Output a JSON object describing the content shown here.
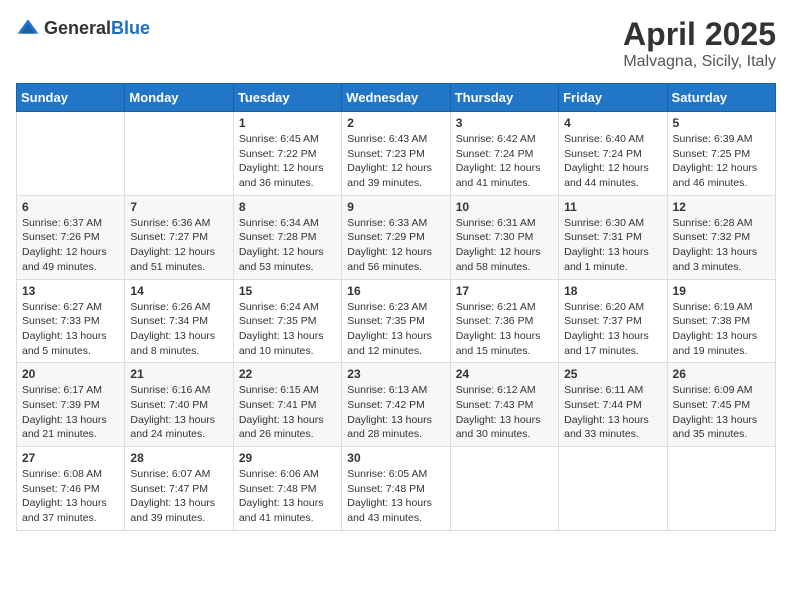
{
  "logo": {
    "text_general": "General",
    "text_blue": "Blue"
  },
  "title": {
    "month": "April 2025",
    "location": "Malvagna, Sicily, Italy"
  },
  "days_of_week": [
    "Sunday",
    "Monday",
    "Tuesday",
    "Wednesday",
    "Thursday",
    "Friday",
    "Saturday"
  ],
  "weeks": [
    [
      {
        "day": "",
        "info": ""
      },
      {
        "day": "",
        "info": ""
      },
      {
        "day": "1",
        "info": "Sunrise: 6:45 AM\nSunset: 7:22 PM\nDaylight: 12 hours and 36 minutes."
      },
      {
        "day": "2",
        "info": "Sunrise: 6:43 AM\nSunset: 7:23 PM\nDaylight: 12 hours and 39 minutes."
      },
      {
        "day": "3",
        "info": "Sunrise: 6:42 AM\nSunset: 7:24 PM\nDaylight: 12 hours and 41 minutes."
      },
      {
        "day": "4",
        "info": "Sunrise: 6:40 AM\nSunset: 7:24 PM\nDaylight: 12 hours and 44 minutes."
      },
      {
        "day": "5",
        "info": "Sunrise: 6:39 AM\nSunset: 7:25 PM\nDaylight: 12 hours and 46 minutes."
      }
    ],
    [
      {
        "day": "6",
        "info": "Sunrise: 6:37 AM\nSunset: 7:26 PM\nDaylight: 12 hours and 49 minutes."
      },
      {
        "day": "7",
        "info": "Sunrise: 6:36 AM\nSunset: 7:27 PM\nDaylight: 12 hours and 51 minutes."
      },
      {
        "day": "8",
        "info": "Sunrise: 6:34 AM\nSunset: 7:28 PM\nDaylight: 12 hours and 53 minutes."
      },
      {
        "day": "9",
        "info": "Sunrise: 6:33 AM\nSunset: 7:29 PM\nDaylight: 12 hours and 56 minutes."
      },
      {
        "day": "10",
        "info": "Sunrise: 6:31 AM\nSunset: 7:30 PM\nDaylight: 12 hours and 58 minutes."
      },
      {
        "day": "11",
        "info": "Sunrise: 6:30 AM\nSunset: 7:31 PM\nDaylight: 13 hours and 1 minute."
      },
      {
        "day": "12",
        "info": "Sunrise: 6:28 AM\nSunset: 7:32 PM\nDaylight: 13 hours and 3 minutes."
      }
    ],
    [
      {
        "day": "13",
        "info": "Sunrise: 6:27 AM\nSunset: 7:33 PM\nDaylight: 13 hours and 5 minutes."
      },
      {
        "day": "14",
        "info": "Sunrise: 6:26 AM\nSunset: 7:34 PM\nDaylight: 13 hours and 8 minutes."
      },
      {
        "day": "15",
        "info": "Sunrise: 6:24 AM\nSunset: 7:35 PM\nDaylight: 13 hours and 10 minutes."
      },
      {
        "day": "16",
        "info": "Sunrise: 6:23 AM\nSunset: 7:35 PM\nDaylight: 13 hours and 12 minutes."
      },
      {
        "day": "17",
        "info": "Sunrise: 6:21 AM\nSunset: 7:36 PM\nDaylight: 13 hours and 15 minutes."
      },
      {
        "day": "18",
        "info": "Sunrise: 6:20 AM\nSunset: 7:37 PM\nDaylight: 13 hours and 17 minutes."
      },
      {
        "day": "19",
        "info": "Sunrise: 6:19 AM\nSunset: 7:38 PM\nDaylight: 13 hours and 19 minutes."
      }
    ],
    [
      {
        "day": "20",
        "info": "Sunrise: 6:17 AM\nSunset: 7:39 PM\nDaylight: 13 hours and 21 minutes."
      },
      {
        "day": "21",
        "info": "Sunrise: 6:16 AM\nSunset: 7:40 PM\nDaylight: 13 hours and 24 minutes."
      },
      {
        "day": "22",
        "info": "Sunrise: 6:15 AM\nSunset: 7:41 PM\nDaylight: 13 hours and 26 minutes."
      },
      {
        "day": "23",
        "info": "Sunrise: 6:13 AM\nSunset: 7:42 PM\nDaylight: 13 hours and 28 minutes."
      },
      {
        "day": "24",
        "info": "Sunrise: 6:12 AM\nSunset: 7:43 PM\nDaylight: 13 hours and 30 minutes."
      },
      {
        "day": "25",
        "info": "Sunrise: 6:11 AM\nSunset: 7:44 PM\nDaylight: 13 hours and 33 minutes."
      },
      {
        "day": "26",
        "info": "Sunrise: 6:09 AM\nSunset: 7:45 PM\nDaylight: 13 hours and 35 minutes."
      }
    ],
    [
      {
        "day": "27",
        "info": "Sunrise: 6:08 AM\nSunset: 7:46 PM\nDaylight: 13 hours and 37 minutes."
      },
      {
        "day": "28",
        "info": "Sunrise: 6:07 AM\nSunset: 7:47 PM\nDaylight: 13 hours and 39 minutes."
      },
      {
        "day": "29",
        "info": "Sunrise: 6:06 AM\nSunset: 7:48 PM\nDaylight: 13 hours and 41 minutes."
      },
      {
        "day": "30",
        "info": "Sunrise: 6:05 AM\nSunset: 7:48 PM\nDaylight: 13 hours and 43 minutes."
      },
      {
        "day": "",
        "info": ""
      },
      {
        "day": "",
        "info": ""
      },
      {
        "day": "",
        "info": ""
      }
    ]
  ]
}
